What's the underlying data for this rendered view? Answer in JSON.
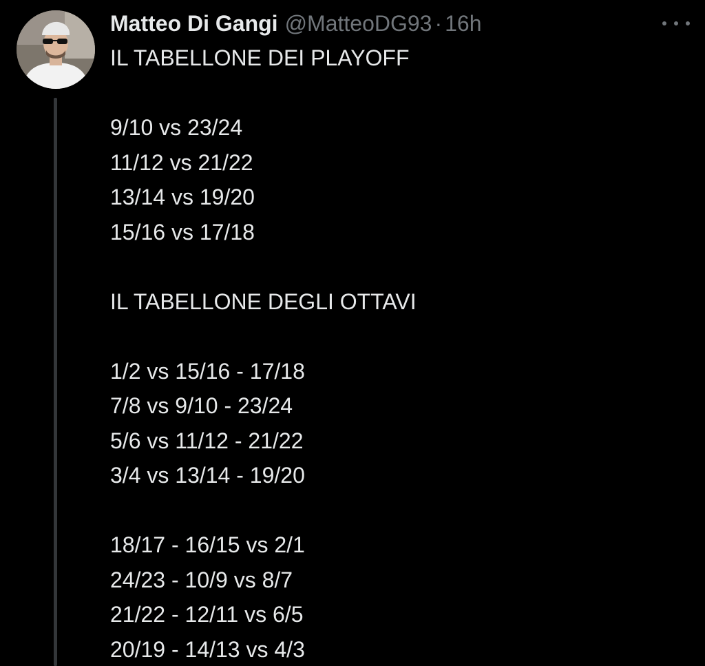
{
  "tweet": {
    "author_name": "Matteo Di Gangi",
    "handle": "@MatteoDG93",
    "separator": "·",
    "time": "16h",
    "lines": [
      "IL TABELLONE DEI PLAYOFF",
      "",
      "9/10 vs 23/24",
      "11/12 vs 21/22",
      "13/14 vs 19/20",
      "15/16 vs 17/18",
      "",
      "IL TABELLONE DEGLI OTTAVI",
      "",
      "1/2 vs 15/16 - 17/18",
      "7/8 vs 9/10 - 23/24",
      "5/6 vs 11/12 - 21/22",
      "3/4 vs 13/14 - 19/20",
      "",
      "18/17 - 16/15 vs 2/1",
      "24/23 - 10/9 vs 8/7",
      "21/22 - 12/11 vs 6/5",
      "20/19 - 14/13 vs 4/3"
    ]
  },
  "icons": {
    "more": "more-horizontal-icon",
    "avatar": "profile-avatar"
  },
  "colors": {
    "background": "#000000",
    "text": "#e7e9ea",
    "secondary": "#71767b",
    "thread_line": "#333639"
  }
}
